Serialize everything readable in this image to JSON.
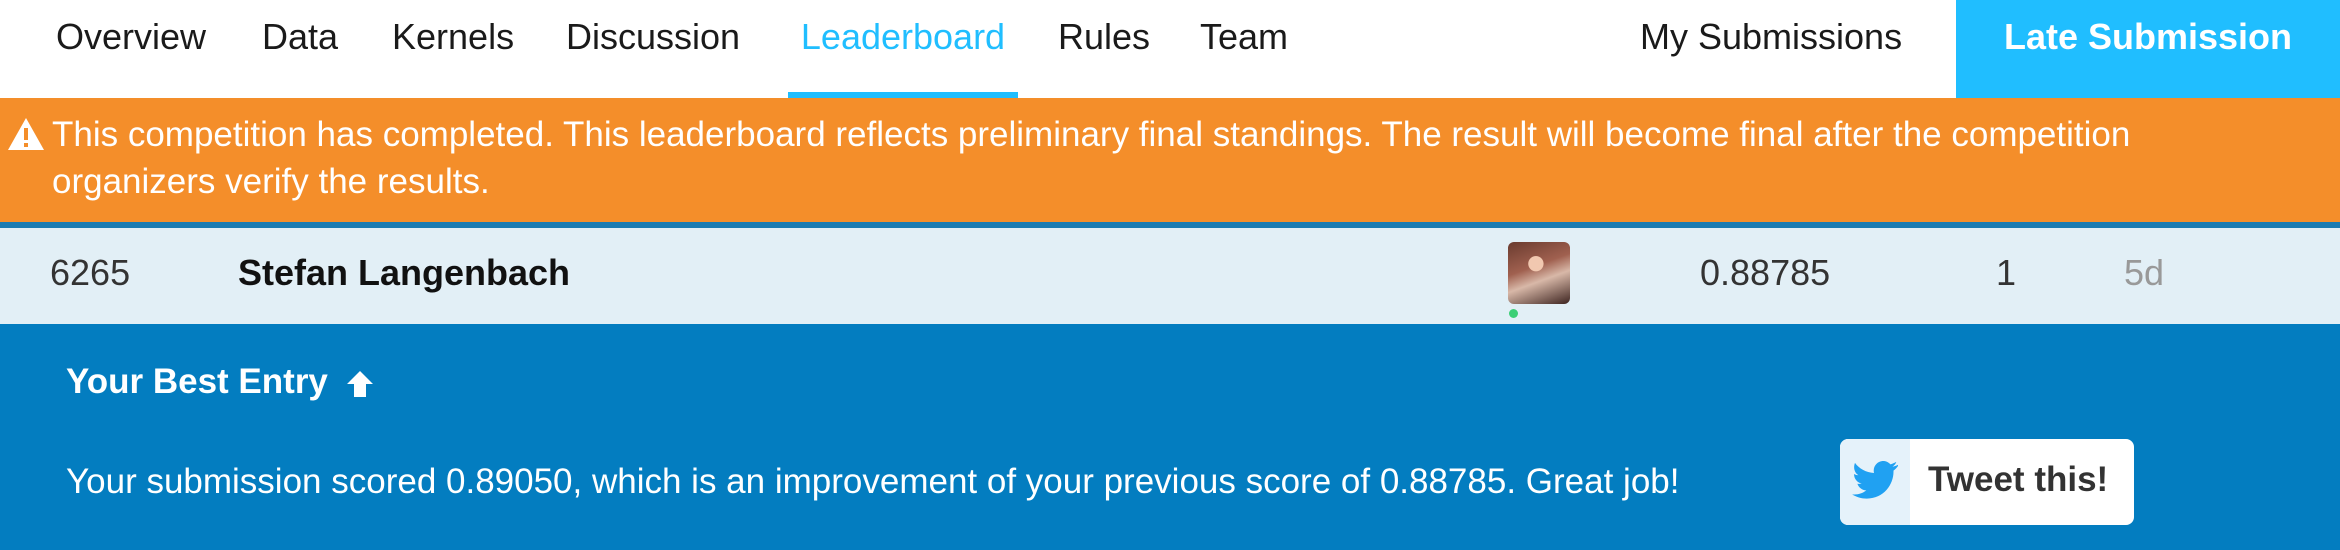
{
  "nav": {
    "tabs": [
      {
        "label": "Overview",
        "active": false
      },
      {
        "label": "Data",
        "active": false
      },
      {
        "label": "Kernels",
        "active": false
      },
      {
        "label": "Discussion",
        "active": false
      },
      {
        "label": "Leaderboard",
        "active": true
      },
      {
        "label": "Rules",
        "active": false
      },
      {
        "label": "Team",
        "active": false
      }
    ],
    "my_submissions_label": "My Submissions",
    "late_submission_label": "Late Submission",
    "accent_color": "#20beff"
  },
  "banner": {
    "icon": "warning-icon",
    "text": "This competition has completed. This leaderboard reflects preliminary final standings. The result will become final after the competition organizers verify the results.",
    "color": "#f48e2a"
  },
  "leaderboard_row": {
    "rank": "6265",
    "team_name": "Stefan Langenbach",
    "avatar_icon": "user-avatar",
    "score": "0.88785",
    "entries": "1",
    "last": "5d",
    "highlight_color": "#e2eff6"
  },
  "best_entry": {
    "title": "Your Best Entry",
    "title_icon": "arrow-up-icon",
    "message": "Your submission scored 0.89050, which is an improvement of your previous score of 0.88785. Great job!",
    "tweet_label": "Tweet this!",
    "tweet_icon": "twitter-icon",
    "panel_color": "#037dc0"
  }
}
